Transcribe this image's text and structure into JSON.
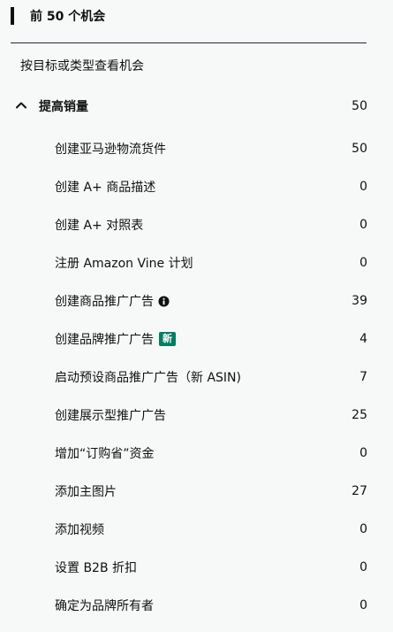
{
  "header": {
    "title": "前 50 个机会"
  },
  "filter_label": "按目标或类型查看机会",
  "group": {
    "label": "提高销量",
    "count": "50"
  },
  "items": [
    {
      "label": "创建亚马逊物流货件",
      "count": "50"
    },
    {
      "label": "创建 A+ 商品描述",
      "count": "0"
    },
    {
      "label": "创建 A+ 对照表",
      "count": "0"
    },
    {
      "label": "注册 Amazon Vine 计划",
      "count": "0"
    },
    {
      "label": "创建商品推广广告",
      "count": "39"
    },
    {
      "label": "创建品牌推广广告",
      "count": "4",
      "badge": "新"
    },
    {
      "label": "启动预设商品推广广告（新 ASIN)",
      "count": "7"
    },
    {
      "label": "创建展示型推广广告",
      "count": "25"
    },
    {
      "label": "增加“订购省”资金",
      "count": "0"
    },
    {
      "label": "添加主图片",
      "count": "27"
    },
    {
      "label": "添加视频",
      "count": "0"
    },
    {
      "label": "设置 B2B 折扣",
      "count": "0"
    },
    {
      "label": "确定为品牌所有者",
      "count": "0"
    }
  ],
  "colors": {
    "badge": "#067d62",
    "text": "#0f1111",
    "background": "#f7f8f8"
  },
  "icons": {
    "group_toggle": "chevron-up-icon",
    "info": "info-icon"
  }
}
